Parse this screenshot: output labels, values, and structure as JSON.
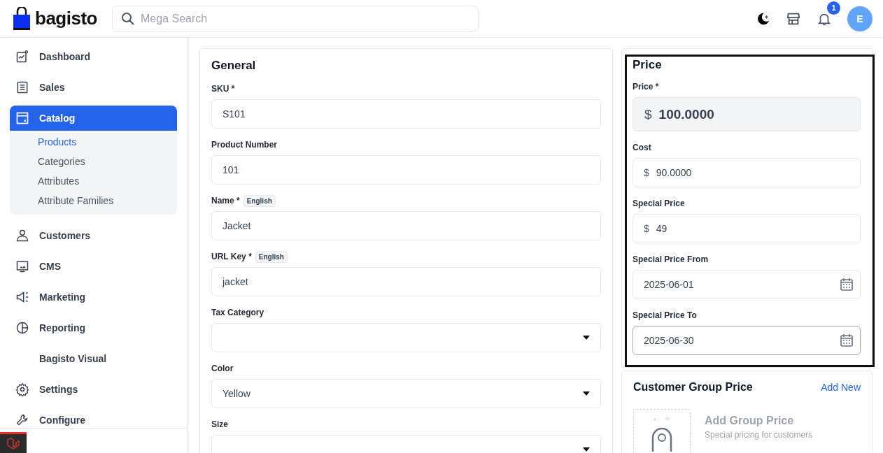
{
  "header": {
    "logo": "bagisto",
    "search": {
      "placeholder": "Mega Search"
    },
    "notification_count": "1",
    "avatar": "E"
  },
  "sidebar": {
    "items": [
      {
        "label": "Dashboard",
        "selected": false
      },
      {
        "label": "Sales",
        "selected": false
      },
      {
        "label": "Catalog",
        "selected": true,
        "children": [
          {
            "label": "Products",
            "selected": true
          },
          {
            "label": "Categories",
            "selected": false
          },
          {
            "label": "Attributes",
            "selected": false
          },
          {
            "label": "Attribute Families",
            "selected": false
          }
        ]
      },
      {
        "label": "Customers",
        "selected": false
      },
      {
        "label": "CMS",
        "selected": false
      },
      {
        "label": "Marketing",
        "selected": false
      },
      {
        "label": "Reporting",
        "selected": false
      },
      {
        "label": "Bagisto Visual",
        "selected": false
      },
      {
        "label": "Settings",
        "selected": false
      },
      {
        "label": "Configure",
        "selected": false
      }
    ]
  },
  "general": {
    "title": "General",
    "fields": [
      {
        "kind": "text",
        "label": "SKU *",
        "value": "S101"
      },
      {
        "kind": "text",
        "label": "Product Number",
        "value": "101"
      },
      {
        "kind": "text",
        "label": "Name *",
        "badge": "English",
        "value": "Jacket"
      },
      {
        "kind": "text",
        "label": "URL Key *",
        "badge": "English",
        "value": "jacket"
      },
      {
        "kind": "select",
        "label": "Tax Category"
      },
      {
        "kind": "select",
        "label": "Color",
        "value": "Yellow"
      },
      {
        "kind": "select",
        "label": "Size"
      }
    ]
  },
  "price": {
    "title": "Price",
    "fields": [
      {
        "kind": "currency-large",
        "label": "Price *",
        "prefix": "$",
        "value": "100.0000"
      },
      {
        "kind": "currency",
        "label": "Cost",
        "prefix": "$",
        "value": "90.0000"
      },
      {
        "kind": "currency",
        "label": "Special Price",
        "prefix": "$",
        "value": "49"
      },
      {
        "kind": "date",
        "label": "Special Price From",
        "value": "2025-06-01",
        "focused": false
      },
      {
        "kind": "date",
        "label": "Special Price To",
        "value": "2025-06-30",
        "focused": true
      }
    ]
  },
  "customer_group_price": {
    "title": "Customer Group Price",
    "link": "Add New",
    "empty_title": "Add Group Price",
    "empty_text": "Special pricing for customers"
  }
}
